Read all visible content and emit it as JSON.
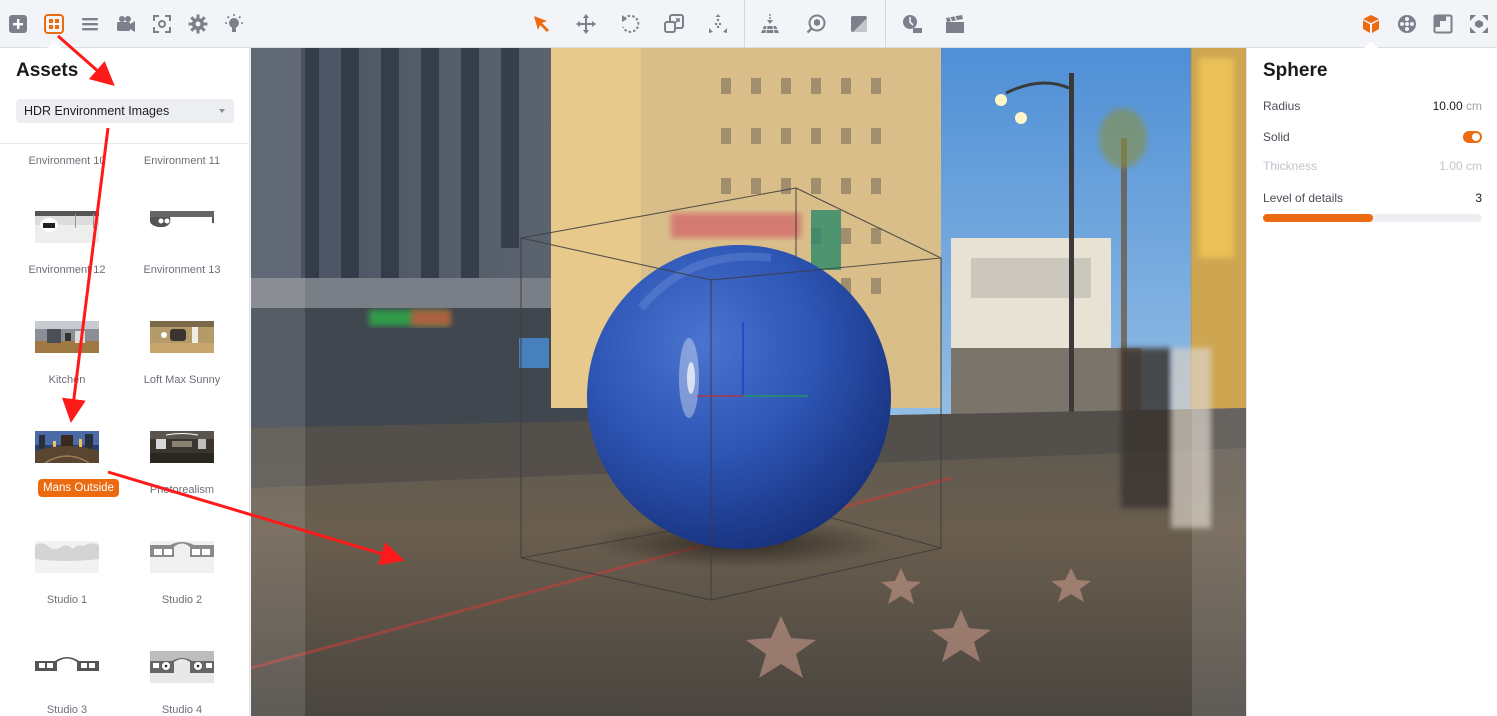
{
  "colors": {
    "accent": "#ec6a10",
    "icon_gray": "#7c808a",
    "annotation_red": "#ff1a1a"
  },
  "toolbar": {
    "left_tools": [
      {
        "icon": "add-icon",
        "label": "Add"
      },
      {
        "icon": "assets-icon",
        "label": "Assets",
        "active": true
      },
      {
        "icon": "list-icon",
        "label": "Scene list"
      },
      {
        "icon": "camera-icon",
        "label": "Camera"
      },
      {
        "icon": "focus-icon",
        "label": "Focus"
      },
      {
        "icon": "gear-icon",
        "label": "Settings"
      },
      {
        "icon": "light-icon",
        "label": "Lighting"
      }
    ],
    "center_tools": [
      {
        "icon": "select-arrow-icon",
        "label": "Select",
        "active": true
      },
      {
        "icon": "move-icon",
        "label": "Move"
      },
      {
        "icon": "rotate-icon",
        "label": "Rotate"
      },
      {
        "icon": "scale-icon",
        "label": "Scale"
      },
      {
        "icon": "explode-icon",
        "label": "Explode"
      },
      {
        "icon": "drop-to-floor-icon",
        "label": "Drop to floor"
      },
      {
        "icon": "inspect-object-icon",
        "label": "Inspect object"
      },
      {
        "icon": "material-icon",
        "label": "Material"
      },
      {
        "icon": "render-time-icon",
        "label": "Render time"
      },
      {
        "icon": "clapperboard-icon",
        "label": "Animation"
      }
    ],
    "right_tools": [
      {
        "icon": "object-cube-icon",
        "label": "Object",
        "active": true
      },
      {
        "icon": "material-ball-icon",
        "label": "Materials"
      },
      {
        "icon": "frame-icon",
        "label": "Frame"
      },
      {
        "icon": "fullscreen-icon",
        "label": "Fullscreen"
      }
    ]
  },
  "assets_panel": {
    "title": "Assets",
    "category_select": {
      "value": "HDR Environment Images"
    },
    "items": [
      {
        "label": "Environment 10",
        "thumb": "env10"
      },
      {
        "label": "Environment 11",
        "thumb": "env11"
      },
      {
        "label": "Environment 12",
        "thumb": "env12"
      },
      {
        "label": "Environment 13",
        "thumb": "env13"
      },
      {
        "label": "Kitchen",
        "thumb": "kitchen"
      },
      {
        "label": "Loft Max Sunny",
        "thumb": "loft"
      },
      {
        "label": "Mans Outside",
        "thumb": "mans",
        "selected": true
      },
      {
        "label": "Photorealism",
        "thumb": "photo"
      },
      {
        "label": "Studio 1",
        "thumb": "studio1"
      },
      {
        "label": "Studio 2",
        "thumb": "studio2"
      },
      {
        "label": "Studio 3",
        "thumb": "studio3"
      },
      {
        "label": "Studio 4",
        "thumb": "studio4"
      }
    ]
  },
  "properties_panel": {
    "title": "Sphere",
    "radius": {
      "label": "Radius",
      "value": "10.00",
      "unit": "cm"
    },
    "solid": {
      "label": "Solid",
      "on": true
    },
    "thickness": {
      "label": "Thickness",
      "value": "1.00",
      "unit": "cm",
      "disabled": true
    },
    "level_of_details": {
      "label": "Level of details",
      "value": "3",
      "fraction": 0.5
    }
  }
}
